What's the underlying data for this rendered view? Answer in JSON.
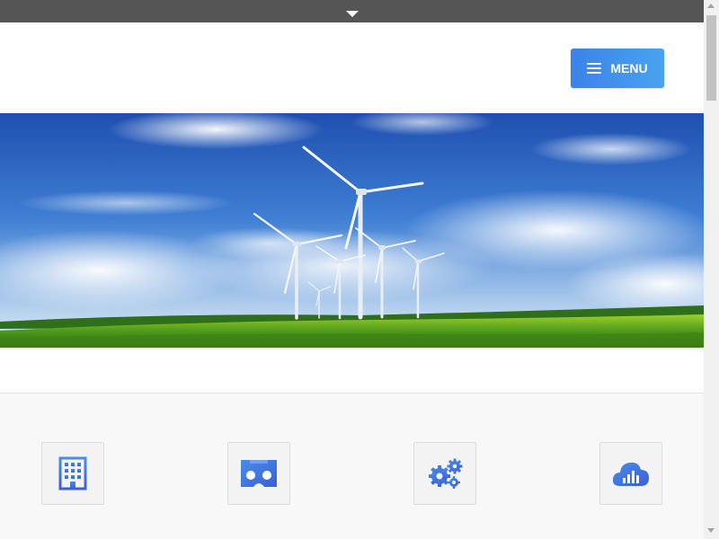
{
  "header": {
    "menu_label": "MENU"
  },
  "hero": {
    "image": "wind-turbines-field-photo"
  },
  "features": {
    "items": [
      {
        "icon": "building-icon"
      },
      {
        "icon": "vr-headset-icon"
      },
      {
        "icon": "gears-icon"
      },
      {
        "icon": "cloud-chart-icon"
      }
    ]
  },
  "colors": {
    "topbar": "#555555",
    "menu_button_start": "#3b82e8",
    "menu_button_end": "#49a3ef",
    "feature_bg": "#f8f8f8",
    "icon_blue": "#3e6fe0"
  }
}
